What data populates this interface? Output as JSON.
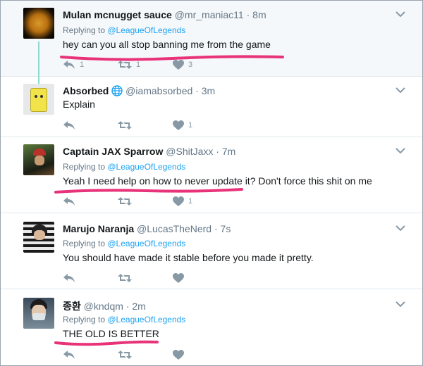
{
  "colors": {
    "link": "#1da1f2",
    "muted": "#657786",
    "underline": "#e8337a",
    "thread": "#8fd8d2"
  },
  "tweets": [
    {
      "name": "Mulan mcnugget sauce",
      "handle": "@mr_maniac11",
      "dot": "·",
      "time": "8m",
      "replying_prefix": "Replying to ",
      "replying_to": "@LeagueOfLegends",
      "text": "hey can you all stop banning me from the game",
      "counts": {
        "reply": "1",
        "retweet": "1",
        "like": "3"
      },
      "icons": [
        "reply-icon",
        "retweet-icon",
        "like-icon",
        "caret-down-icon"
      ]
    },
    {
      "name": "Absorbed",
      "verified_icon": "globe-icon",
      "handle": "@iamabsorbed",
      "dot": "·",
      "time": "3m",
      "text": "Explain",
      "counts": {
        "reply": "",
        "retweet": "",
        "like": "1"
      }
    },
    {
      "name": "Captain JAX Sparrow",
      "handle": "@ShitJaxx",
      "dot": "·",
      "time": "7m",
      "replying_prefix": "Replying to ",
      "replying_to": "@LeagueOfLegends",
      "text": "Yeah I need help on how to never update it? Don't force this shit on me",
      "counts": {
        "reply": "",
        "retweet": "",
        "like": "1"
      }
    },
    {
      "name": "Marujo Naranja",
      "handle": "@LucasTheNerd",
      "dot": "·",
      "time": "7s",
      "replying_prefix": "Replying to ",
      "replying_to": "@LeagueOfLegends",
      "text": "You should have made it stable before you made it pretty.",
      "counts": {
        "reply": "",
        "retweet": "",
        "like": ""
      }
    },
    {
      "name": "종환",
      "handle": "@kndqm",
      "dot": "·",
      "time": "2m",
      "replying_prefix": "Replying to ",
      "replying_to": "@LeagueOfLegends",
      "text": "THE OLD IS BETTER",
      "counts": {
        "reply": "",
        "retweet": "",
        "like": ""
      }
    }
  ]
}
